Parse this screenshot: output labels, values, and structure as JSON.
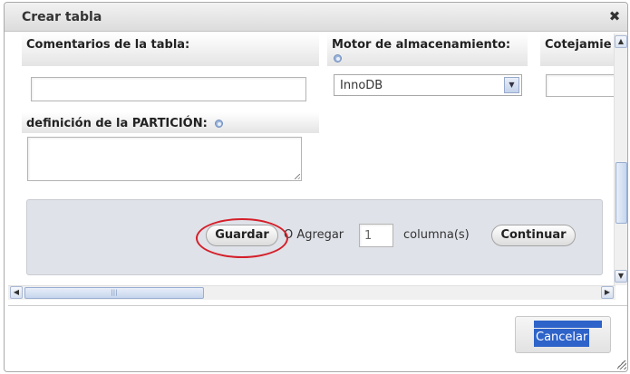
{
  "dialog": {
    "title": "Crear tabla",
    "close_glyph": "✖"
  },
  "form": {
    "comments_label": "Comentarios de la tabla:",
    "comments_value": "",
    "engine_label": "Motor de almacenamiento:",
    "engine_value": "InnoDB",
    "collation_label": "Cotejamie",
    "collation_value": "",
    "partition_label": "definición de la PARTICIÓN:",
    "partition_value": ""
  },
  "actions": {
    "save_label": "Guardar",
    "or_add_label": "O Agregar",
    "columns_count": "1",
    "columns_label": "columna(s)",
    "continue_label": "Continuar",
    "cancel_label": "Cancelar"
  },
  "scrollbars": {
    "up_glyph": "▲",
    "down_glyph": "▼",
    "left_glyph": "◀",
    "right_glyph": "▶",
    "grip_glyph": "|||"
  },
  "icons": {
    "help": "help-icon",
    "dropdown": "chevron-down-icon",
    "close": "close-icon"
  },
  "colors": {
    "annotation_circle": "#d41f2a",
    "selection": "#2e63c9",
    "panel_bg": "#dfe2e8"
  }
}
